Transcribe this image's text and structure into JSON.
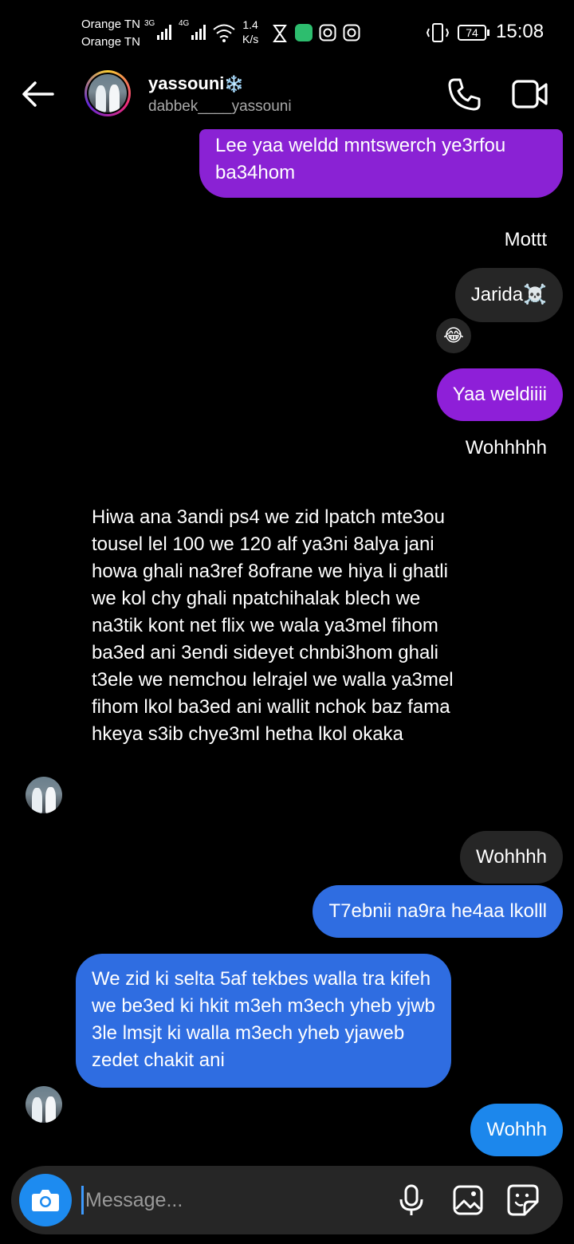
{
  "status_bar": {
    "carrier1": "Orange TN",
    "carrier2": "Orange TN",
    "net1": "3G",
    "net2": "4G",
    "speed_value": "1.4",
    "speed_unit": "K/s",
    "battery": "74",
    "time": "15:08"
  },
  "header": {
    "name": "yassouni",
    "name_badge": "❄️",
    "handle": "dabbek____yassouni",
    "icons": [
      "back-arrow-icon",
      "phone-icon",
      "video-icon"
    ]
  },
  "messages": {
    "m1": "Lee yaa weldd mntswerch ye3rfou ba34hom",
    "m2": "Mottt",
    "m3": "Jarida☠️",
    "m3_reaction": "😂",
    "m4": "Yaa weldiiii",
    "m5": "Wohhhhh",
    "m6": "Hiwa ana 3andi ps4 we zid lpatch mte3ou tousel lel 100 we 120 alf ya3ni 8alya jani howa ghali na3ref 8ofrane we hiya li ghatli we kol chy ghali npatchihalak blech we na3tik kont net flix we wala ya3mel fihom ba3ed ani 3endi sideyet chnbi3hom ghali t3ele we nemchou lelrajel we walla ya3mel fihom lkol ba3ed ani wallit nchok baz fama hkeya s3ib chye3ml hetha lkol okaka",
    "m7": "Wohhhh",
    "m8": "T7ebnii na9ra he4aa lkolll",
    "m9": "We zid ki selta 5af tekbes walla tra kifeh we be3ed ki hkit m3eh m3ech yheb yjwb 3le lmsjt ki walla m3ech yheb yjaweb zedet chakit ani",
    "m10": "Wohhh"
  },
  "composer": {
    "placeholder": "Message...",
    "icons": [
      "camera-icon",
      "microphone-icon",
      "gallery-icon",
      "sticker-icon"
    ]
  },
  "colors": {
    "purple_bubble": "#8e1fd8",
    "blue_bubble": "#2f6de1",
    "gray_bubble": "#262626",
    "camera_button": "#1d8bf0"
  }
}
